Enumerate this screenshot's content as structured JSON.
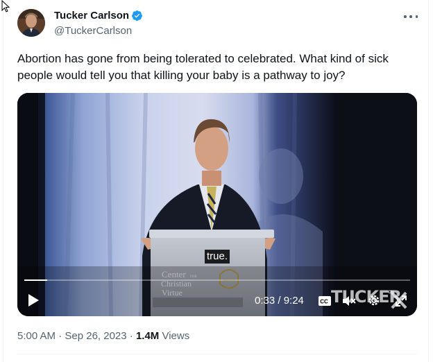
{
  "tweet": {
    "author_name": "Tucker Carlson",
    "author_handle": "@TuckerCarlson",
    "text": "Abortion has gone from being tolerated to celebrated. What kind of sick people would tell you that killing your baby is a pathway to joy?",
    "timestamp": "5:00 AM · Sep 26, 2023 · ",
    "views_count": "1.4M",
    "views_label": " Views"
  },
  "video": {
    "caption": "true.",
    "time": "0:33 / 9:24",
    "progress": 0.0585,
    "podium_sign": [
      "Center",
      "FOR",
      "Christian",
      "Virtue"
    ],
    "watermark": "TUCKER ON X"
  },
  "colors": {
    "verified": "#1d9bf0",
    "text_primary": "#0f1419",
    "text_secondary": "#536471"
  },
  "icons": [
    "cursor-arrow-icon",
    "verified-badge-icon",
    "more-options-icon",
    "play-icon",
    "closed-captions-icon",
    "mute-icon",
    "settings-gear-icon",
    "fullscreen-icon"
  ]
}
